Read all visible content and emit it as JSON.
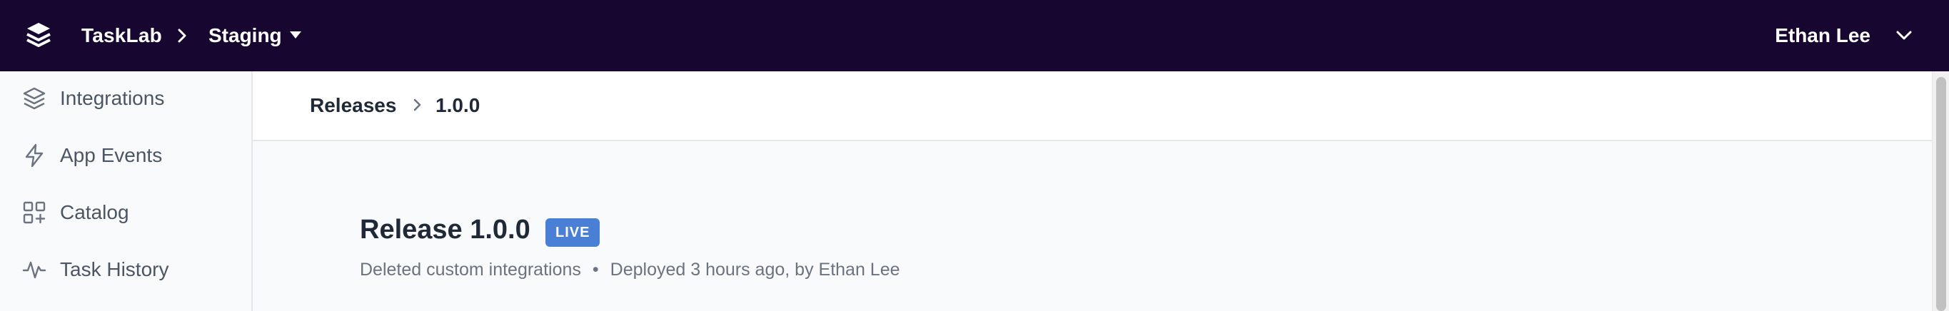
{
  "app": {
    "name": "TaskLab",
    "environment": "Staging",
    "user": "Ethan Lee",
    "logo_icon": "stack-layers-icon"
  },
  "sidebar": {
    "items": [
      {
        "label": "Integrations",
        "icon": "layers-icon"
      },
      {
        "label": "App Events",
        "icon": "bolt-icon"
      },
      {
        "label": "Catalog",
        "icon": "grid-plus-icon"
      },
      {
        "label": "Task History",
        "icon": "activity-icon"
      }
    ]
  },
  "breadcrumb": {
    "root": "Releases",
    "current": "1.0.0"
  },
  "release": {
    "title": "Release 1.0.0",
    "badge": "LIVE",
    "description": "Deleted custom integrations",
    "separator": "•",
    "deployed": "Deployed 3 hours ago, by Ethan Lee"
  },
  "colors": {
    "topbar": "#170630",
    "badge": "#4a7fd6",
    "sidebar_bg": "#f9fafb"
  }
}
